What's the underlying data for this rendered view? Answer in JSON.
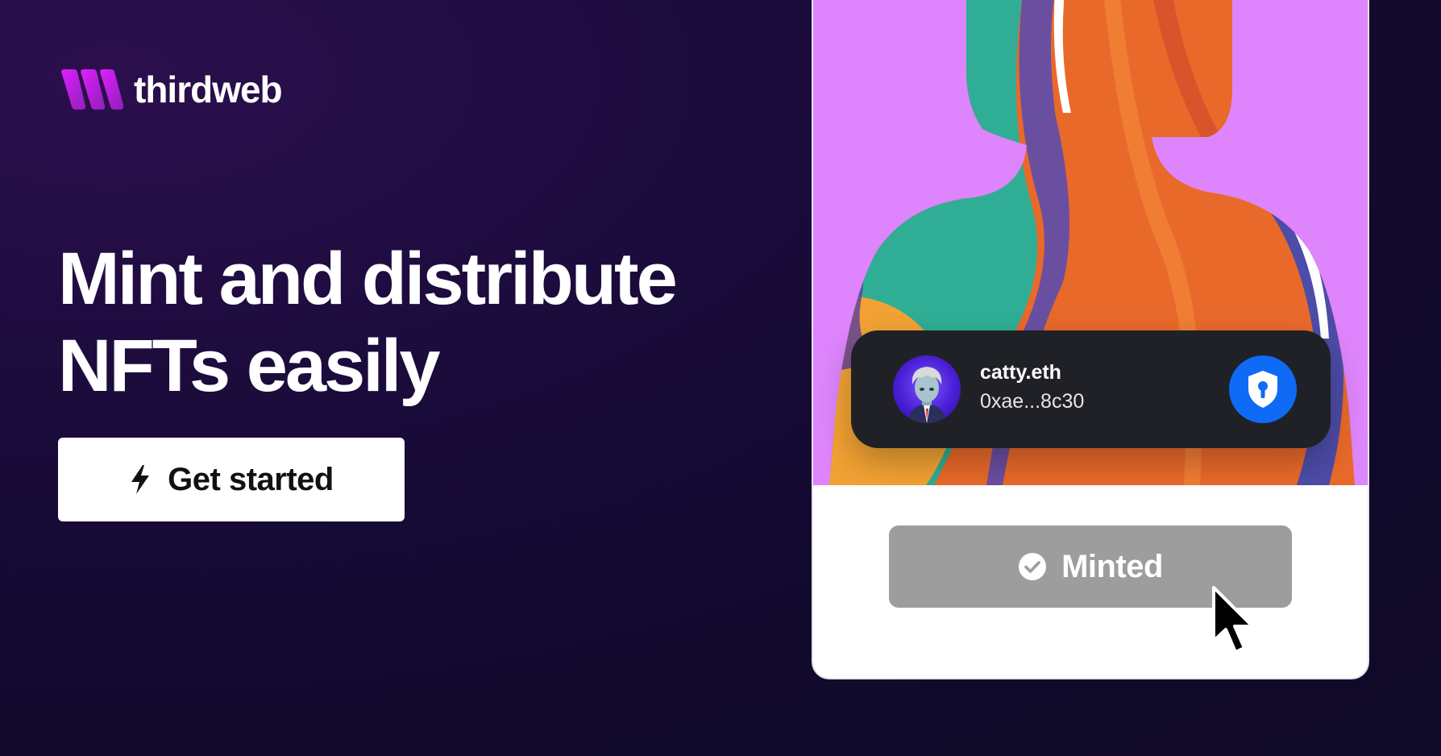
{
  "brand": {
    "name": "thirdweb",
    "logo_icon": "thirdweb-logo-icon",
    "gradient": [
      "#c322ff",
      "#7b1ea8"
    ]
  },
  "hero": {
    "line1": "Mint and distribute",
    "line2": "NFTs easily"
  },
  "cta": {
    "label": "Get started",
    "icon": "bolt-icon"
  },
  "nft_card": {
    "art_background": "#de84fc",
    "wallet": {
      "name": "catty.eth",
      "address": "0xae...8c30",
      "avatar_icon": "avatar-icon",
      "security_icon": "shield-lock-icon",
      "security_color": "#0f6af5"
    },
    "mint_button": {
      "label": "Minted",
      "icon": "check-circle-icon",
      "color": "#9d9d9d"
    }
  },
  "colors": {
    "background": "#150b33",
    "text": "#ffffff"
  }
}
